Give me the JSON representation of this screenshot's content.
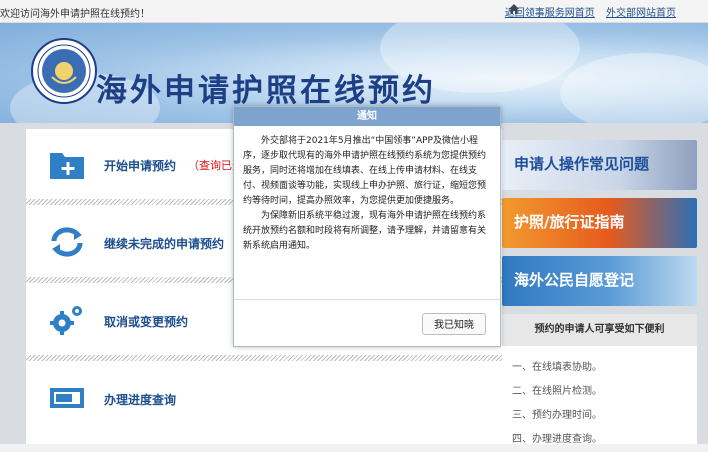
{
  "topbar": {
    "welcome": "欢迎访问海外申请护照在线预约！",
    "links": [
      "返回领事服务网首页",
      "外交部网站首页"
    ]
  },
  "header": {
    "title": "海外申请护照在线预约"
  },
  "menu": {
    "items": [
      {
        "label": "开始申请预约",
        "extra": "（查询已选"
      },
      {
        "label": "继续未完成的申请预约"
      },
      {
        "label": "取消或变更预约"
      },
      {
        "label": "办理进度查询"
      }
    ]
  },
  "right_panel": {
    "banners": [
      "申请人操作常见问题",
      "护照/旅行证指南",
      "海外公民自愿登记"
    ],
    "benefits_title": "预约的申请人可享受如下便利",
    "benefits": [
      "一、在线填表协助。",
      "二、在线照片检测。",
      "三、预约办理时间。",
      "四、办理进度查询。"
    ]
  },
  "modal": {
    "title": "通知",
    "paragraphs": [
      "外交部将于2021年5月推出“中国领事”APP及微信小程序，逐步取代现有的海外申请护照在线预约系统为您提供预约服务，同时还将增加在线填表、在线上传申请材料、在线支付、视频面谈等功能，实现线上申办护照、旅行证，缩短您预约等待时间，提高办照效率，为您提供更加便捷服务。",
      "为保障新旧系统平稳过渡，现有海外申请护照在线预约系统开放预约名额和时段将有所调整，请予理解，并请留意有关新系统启用通知。"
    ],
    "button": "我已知晓"
  },
  "colors": {
    "accent": "#1d4f8f",
    "modal_header": "#7ea3cf",
    "alert_text": "#dd1111"
  }
}
